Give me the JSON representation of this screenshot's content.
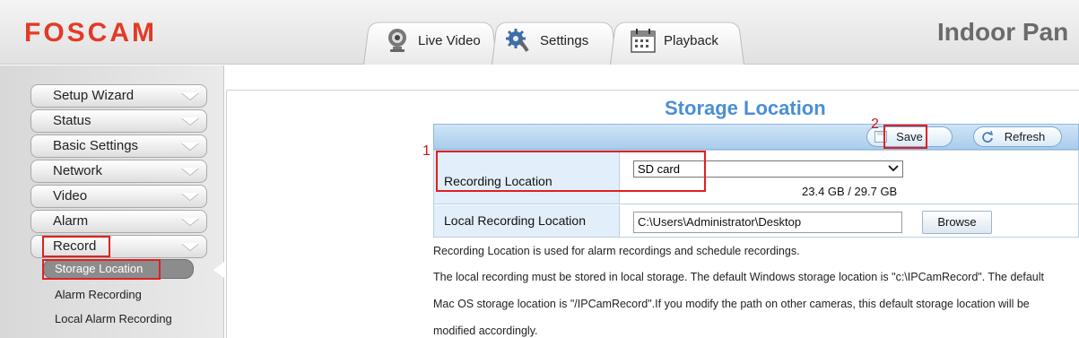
{
  "header": {
    "logo": "FOSCAM",
    "brand_title": "Indoor Pan",
    "tabs": [
      {
        "label": "Live Video",
        "icon": "webcam-icon"
      },
      {
        "label": "Settings",
        "icon": "gears-icon"
      },
      {
        "label": "Playback",
        "icon": "calendar-icon"
      }
    ]
  },
  "sidebar": {
    "items": [
      {
        "label": "Setup Wizard"
      },
      {
        "label": "Status"
      },
      {
        "label": "Basic Settings"
      },
      {
        "label": "Network"
      },
      {
        "label": "Video"
      },
      {
        "label": "Alarm"
      },
      {
        "label": "Record"
      }
    ],
    "sub_items": [
      {
        "label": "Storage Location",
        "active": true
      },
      {
        "label": "Alarm Recording"
      },
      {
        "label": "Local Alarm Recording"
      }
    ]
  },
  "main": {
    "title": "Storage Location",
    "toolbar": {
      "save_label": "Save",
      "refresh_label": "Refresh"
    },
    "fields": {
      "recording_location_label": "Recording Location",
      "recording_location_value": "SD card",
      "capacity": "23.4 GB / 29.7 GB",
      "local_location_label": "Local Recording Location",
      "local_location_value": "C:\\Users\\Administrator\\Desktop",
      "browse_label": "Browse"
    },
    "description": [
      "Recording Location is used for alarm recordings and schedule recordings.",
      "The local recording must be stored in local storage. The default Windows storage location is \"c:\\IPCamRecord\". The default",
      "Mac OS storage location is \"/IPCamRecord\".If you modify the path on other cameras, this default storage location will be",
      "modified accordingly."
    ]
  },
  "annotations": {
    "step1": "1",
    "step2": "2"
  },
  "colors": {
    "accent": "#4a8fd4",
    "logo": "#e23a26",
    "annotation": "#e02020"
  }
}
